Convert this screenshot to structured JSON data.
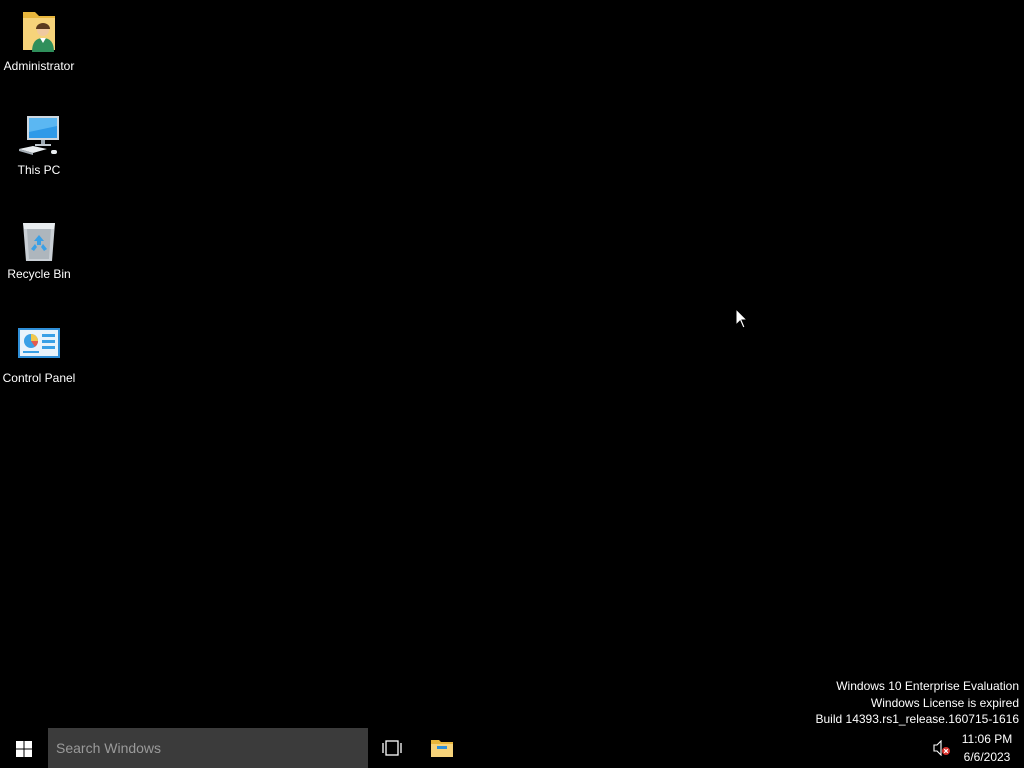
{
  "desktop": {
    "background_color": "#000000",
    "icons": [
      {
        "label": "Administrator",
        "icon": "user-folder-icon"
      },
      {
        "label": "This PC",
        "icon": "computer-icon"
      },
      {
        "label": "Recycle Bin",
        "icon": "recycle-bin-icon"
      },
      {
        "label": "Control Panel",
        "icon": "control-panel-icon"
      }
    ]
  },
  "watermark": {
    "line1": "Windows 10 Enterprise Evaluation",
    "line2": "Windows License is expired",
    "line3": "Build 14393.rs1_release.160715-1616"
  },
  "taskbar": {
    "start_icon": "windows-logo-icon",
    "search_placeholder": "Search Windows",
    "task_view_icon": "task-view-icon",
    "pinned": [
      {
        "icon": "file-explorer-icon"
      }
    ],
    "tray": {
      "volume_icon": "volume-muted-icon",
      "time": "11:06 PM",
      "date": "6/6/2023"
    }
  },
  "colors": {
    "search_box_bg": "#3b3b3b",
    "folder_yellow": "#f2c84b",
    "monitor_blue": "#2f9ae8"
  }
}
